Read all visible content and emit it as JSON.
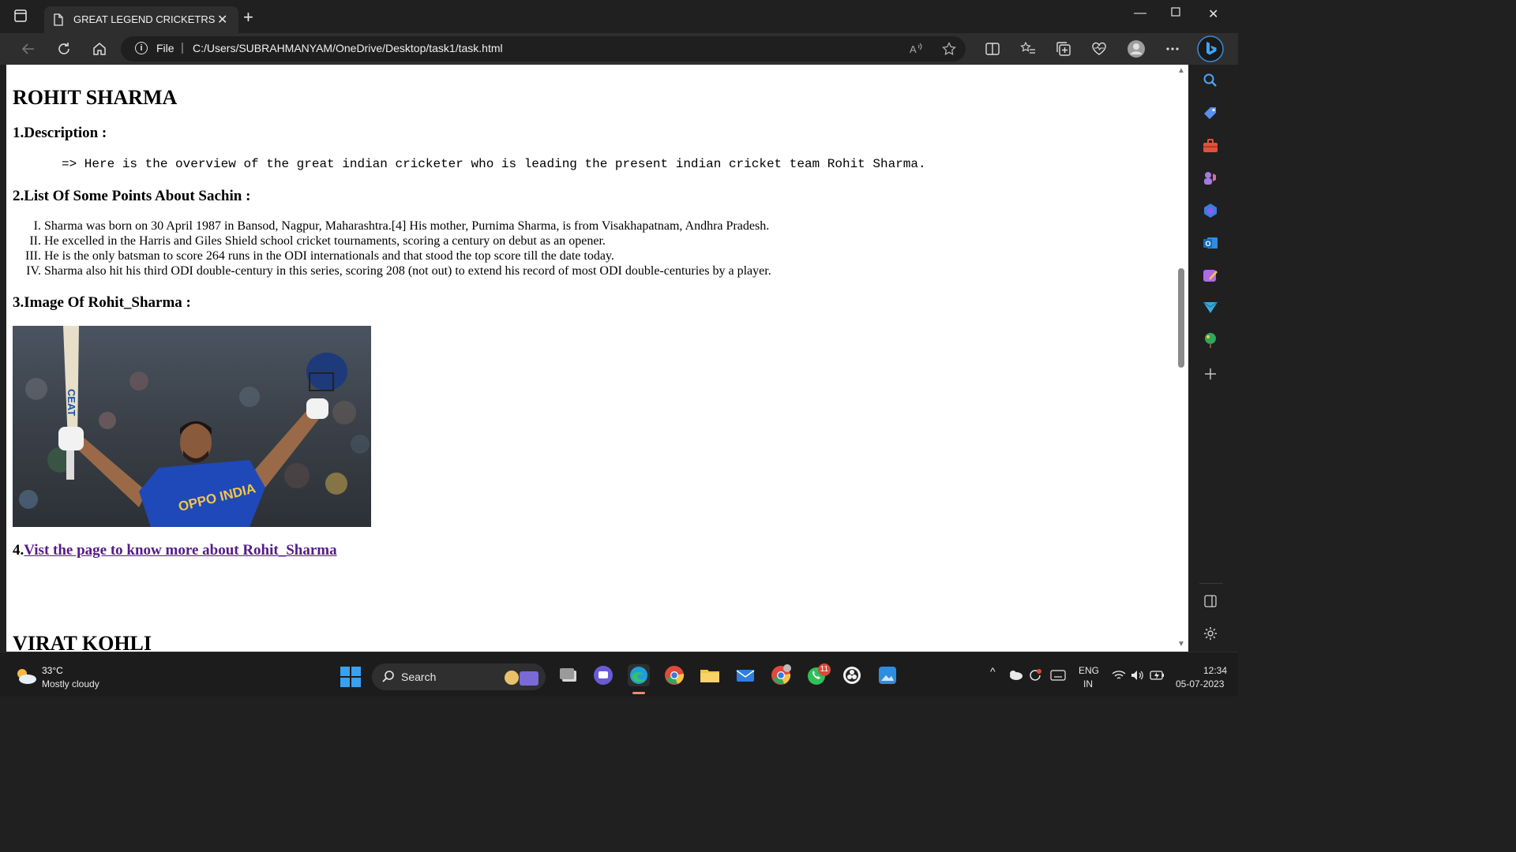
{
  "browser": {
    "tab_title": "GREAT LEGEND CRICKETRS",
    "address_scheme": "File",
    "address_url": "C:/Users/SUBRAHMANYAM/OneDrive/Desktop/task1/task.html"
  },
  "page": {
    "heading": "ROHIT SHARMA",
    "description_heading": "1.Description :",
    "description_text": "=> Here is the overview of the great indian cricketer who is leading the present indian cricket team Rohit Sharma.",
    "points_heading": "2.List Of Some Points About Sachin :",
    "points": [
      "Sharma was born on 30 April 1987 in Bansod, Nagpur, Maharashtra.[4] His mother, Purnima Sharma, is from Visakhapatnam, Andhra Pradesh.",
      "He excelled in the Harris and Giles Shield school cricket tournaments, scoring a century on debut as an opener.",
      "He is the only batsman to score 264 runs in the ODI internationals and that stood the top score till the date today.",
      "Sharma also hit his third ODI double-century in this series, scoring 208 (not out) to extend his record of most ODI double-centuries by a player."
    ],
    "image_heading": "3.Image Of Rohit_Sharma :",
    "image_jersey_text": "OPPO INDIA",
    "image_bat_text": "CEAT",
    "link_prefix": "4.",
    "link_text": "Vist the page to know more about Rohit_Sharma",
    "next_heading": "VIRAT KOHLI"
  },
  "taskbar": {
    "temperature": "33°C",
    "weather": "Mostly cloudy",
    "search_label": "Search",
    "whatsapp_badge": "11",
    "language_1": "ENG",
    "language_2": "IN",
    "time": "12:34",
    "date": "05-07-2023"
  },
  "colors": {
    "link": "#551a8b",
    "chrome_dark": "#202020",
    "toolbar": "#2e2e2e"
  }
}
